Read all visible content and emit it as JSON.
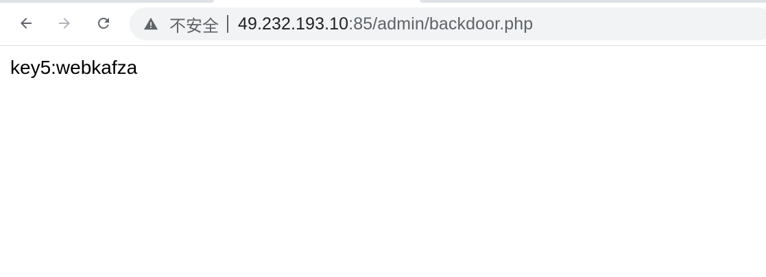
{
  "toolbar": {
    "back_icon": "arrow-left-icon",
    "forward_icon": "arrow-right-icon",
    "reload_icon": "reload-icon"
  },
  "omnibox": {
    "security_icon": "warning-triangle-icon",
    "security_label": "不安全",
    "url_host": "49.232.193.10",
    "url_rest": ":85/admin/backdoor.php"
  },
  "page": {
    "body_text": "key5:webkafza"
  },
  "colors": {
    "icon_active": "#5f6368",
    "icon_disabled": "#b0b3b8",
    "omnibox_bg": "#f1f3f4",
    "url_host": "#202124"
  }
}
